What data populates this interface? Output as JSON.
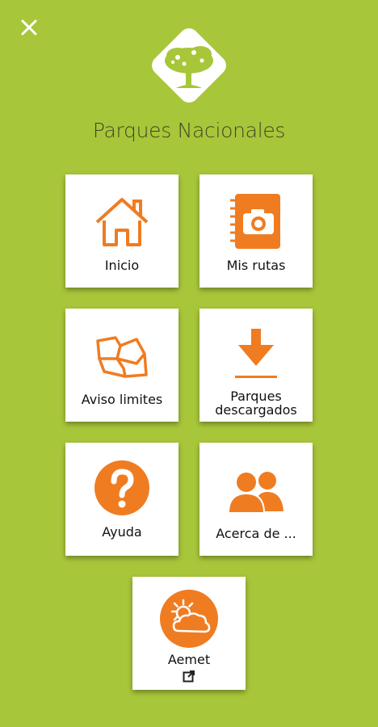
{
  "app": {
    "title": "Parques Nacionales"
  },
  "colors": {
    "background": "#a8c63a",
    "accent": "#f07c21",
    "tile": "#ffffff"
  },
  "menu": {
    "items": [
      {
        "label": "Inicio",
        "icon": "home-icon"
      },
      {
        "label": "Mis rutas",
        "icon": "camera-notebook-icon"
      },
      {
        "label": "Aviso limites",
        "icon": "map-boundaries-icon"
      },
      {
        "label": "Parques",
        "label2": "descargados",
        "icon": "download-icon"
      },
      {
        "label": "Ayuda",
        "icon": "help-icon"
      },
      {
        "label": "Acerca de ...",
        "icon": "people-icon"
      },
      {
        "label": "Aemet",
        "icon": "weather-icon",
        "external": "external-link-icon"
      }
    ]
  }
}
